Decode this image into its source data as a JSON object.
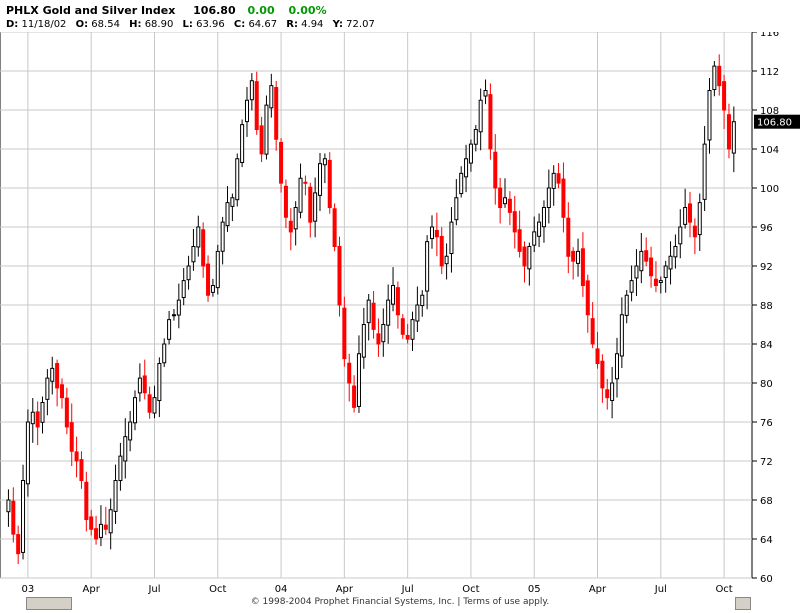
{
  "header": {
    "title": "PHLX Gold and Silver Index",
    "last": "106.80",
    "change": "0.00",
    "change_pct": "0.00%",
    "detail": {
      "date_label": "D:",
      "date": "11/18/02",
      "open_label": "O:",
      "open": "68.54",
      "high_label": "H:",
      "high": "68.90",
      "low_label": "L:",
      "low": "63.96",
      "close_label": "C:",
      "close": "64.67",
      "range_label": "R:",
      "range": "4.94",
      "y_label": "Y:",
      "y": "72.07"
    }
  },
  "footer": {
    "copyright": "© 1998-2004 Prophet Financial Systems, Inc. | Terms of use apply."
  },
  "colors": {
    "up": "#000000",
    "down": "#ff0000",
    "grid": "#c8c8c8",
    "price_tag_bg": "#000000",
    "price_tag_fg": "#ffffff"
  },
  "chart_data": {
    "type": "candlestick",
    "title": "PHLX Gold and Silver Index",
    "ylim": [
      60,
      116
    ],
    "yticks": [
      60,
      64,
      68,
      72,
      76,
      80,
      84,
      88,
      92,
      96,
      100,
      104,
      108,
      112,
      116
    ],
    "x_tick_labels": [
      "03",
      "Apr",
      "Jul",
      "Oct",
      "04",
      "Apr",
      "Jul",
      "Oct",
      "05",
      "Apr",
      "Jul",
      "Oct"
    ],
    "x_tick_weeks": [
      4,
      17,
      30,
      43,
      56,
      69,
      82,
      95,
      108,
      121,
      134,
      147
    ],
    "total_weeks": 152,
    "last_price_label": "106.80",
    "last_price": 106.8,
    "grid": true,
    "closes": [
      68.0,
      64.5,
      62.5,
      70.0,
      76.0,
      77.0,
      75.5,
      78.0,
      80.5,
      81.5,
      79.5,
      78.5,
      75.5,
      73.0,
      72.0,
      70.0,
      66.0,
      65.0,
      64.0,
      65.5,
      65.0,
      67.0,
      70.0,
      72.5,
      74.5,
      76.0,
      78.5,
      80.5,
      79.0,
      77.0,
      78.5,
      82.0,
      84.0,
      86.5,
      87.0,
      88.5,
      90.5,
      92.0,
      94.0,
      96.0,
      92.0,
      89.0,
      90.0,
      93.5,
      96.5,
      98.5,
      99.0,
      103.0,
      106.5,
      109.0,
      111.0,
      106.0,
      103.5,
      108.5,
      110.5,
      105.0,
      100.5,
      97.0,
      95.5,
      98.0,
      101.0,
      100.5,
      96.5,
      99.5,
      102.5,
      103.0,
      98.0,
      94.0,
      88.0,
      82.5,
      80.0,
      77.5,
      83.0,
      86.0,
      88.5,
      85.5,
      84.0,
      86.0,
      88.5,
      90.0,
      87.0,
      85.0,
      84.5,
      86.5,
      88.0,
      89.0,
      94.5,
      96.0,
      95.0,
      92.0,
      93.0,
      96.5,
      99.0,
      101.5,
      103.0,
      104.5,
      106.0,
      109.0,
      110.0,
      104.0,
      100.0,
      98.0,
      99.0,
      97.5,
      95.5,
      93.5,
      92.0,
      94.0,
      95.5,
      96.5,
      98.0,
      100.0,
      101.5,
      100.5,
      97.0,
      93.0,
      92.5,
      93.5,
      90.0,
      87.0,
      84.0,
      82.0,
      79.5,
      78.5,
      80.0,
      83.0,
      87.0,
      89.0,
      90.5,
      92.0,
      93.5,
      92.5,
      91.0,
      90.0,
      90.5,
      92.0,
      93.0,
      94.0,
      96.0,
      98.0,
      96.5,
      95.0,
      98.5,
      104.5,
      110.0,
      112.5,
      110.5,
      108.0,
      104.0,
      106.8
    ]
  }
}
